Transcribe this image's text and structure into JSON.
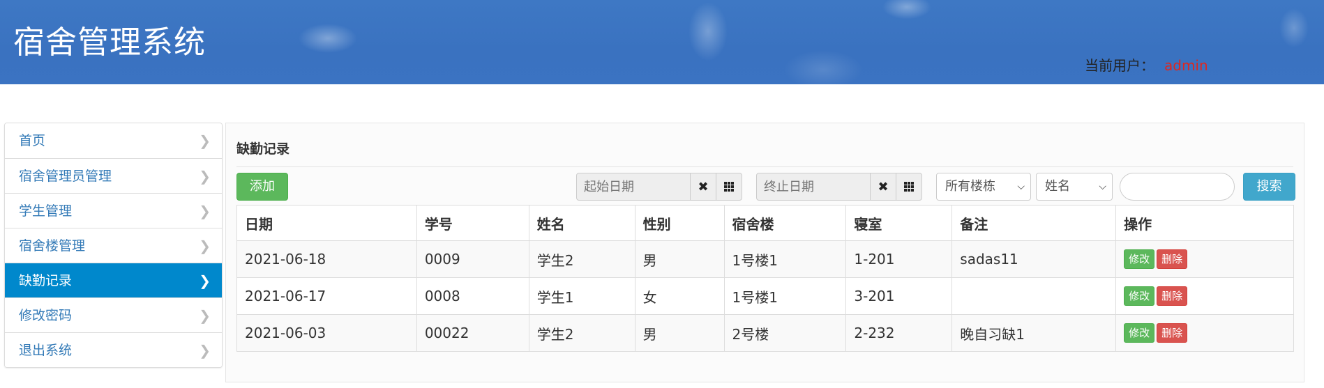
{
  "header": {
    "app_title": "宿舍管理系统",
    "current_user_label": "当前用户：",
    "current_user": "admin"
  },
  "sidebar": {
    "items": [
      {
        "label": "首页",
        "active": false
      },
      {
        "label": "宿舍管理员管理",
        "active": false
      },
      {
        "label": "学生管理",
        "active": false
      },
      {
        "label": "宿舍楼管理",
        "active": false
      },
      {
        "label": "缺勤记录",
        "active": true
      },
      {
        "label": "修改密码",
        "active": false
      },
      {
        "label": "退出系统",
        "active": false
      }
    ]
  },
  "main": {
    "title": "缺勤记录",
    "toolbar": {
      "add_label": "添加",
      "start_date_placeholder": "起始日期",
      "end_date_placeholder": "终止日期",
      "building_select": "所有楼栋",
      "field_select": "姓名",
      "search_value": "",
      "search_label": "搜索"
    },
    "table": {
      "columns": [
        "日期",
        "学号",
        "姓名",
        "性别",
        "宿舍楼",
        "寝室",
        "备注",
        "操作"
      ],
      "rows": [
        {
          "date": "2021-06-18",
          "student_no": "0009",
          "name": "学生2",
          "gender": "男",
          "building": "1号楼1",
          "room": "1-201",
          "remark": "sadas11"
        },
        {
          "date": "2021-06-17",
          "student_no": "0008",
          "name": "学生1",
          "gender": "女",
          "building": "1号楼1",
          "room": "3-201",
          "remark": ""
        },
        {
          "date": "2021-06-03",
          "student_no": "00022",
          "name": "学生2",
          "gender": "男",
          "building": "2号楼",
          "room": "2-232",
          "remark": "晚自习缺1"
        }
      ],
      "edit_label": "修改",
      "delete_label": "删除"
    }
  },
  "colors": {
    "header_bg": "#3b73c2",
    "active_nav": "#0088cc",
    "link": "#337ab7",
    "success": "#5cb85c",
    "danger": "#d9534f",
    "info": "#41a7cc",
    "user_name": "#e0261e"
  }
}
